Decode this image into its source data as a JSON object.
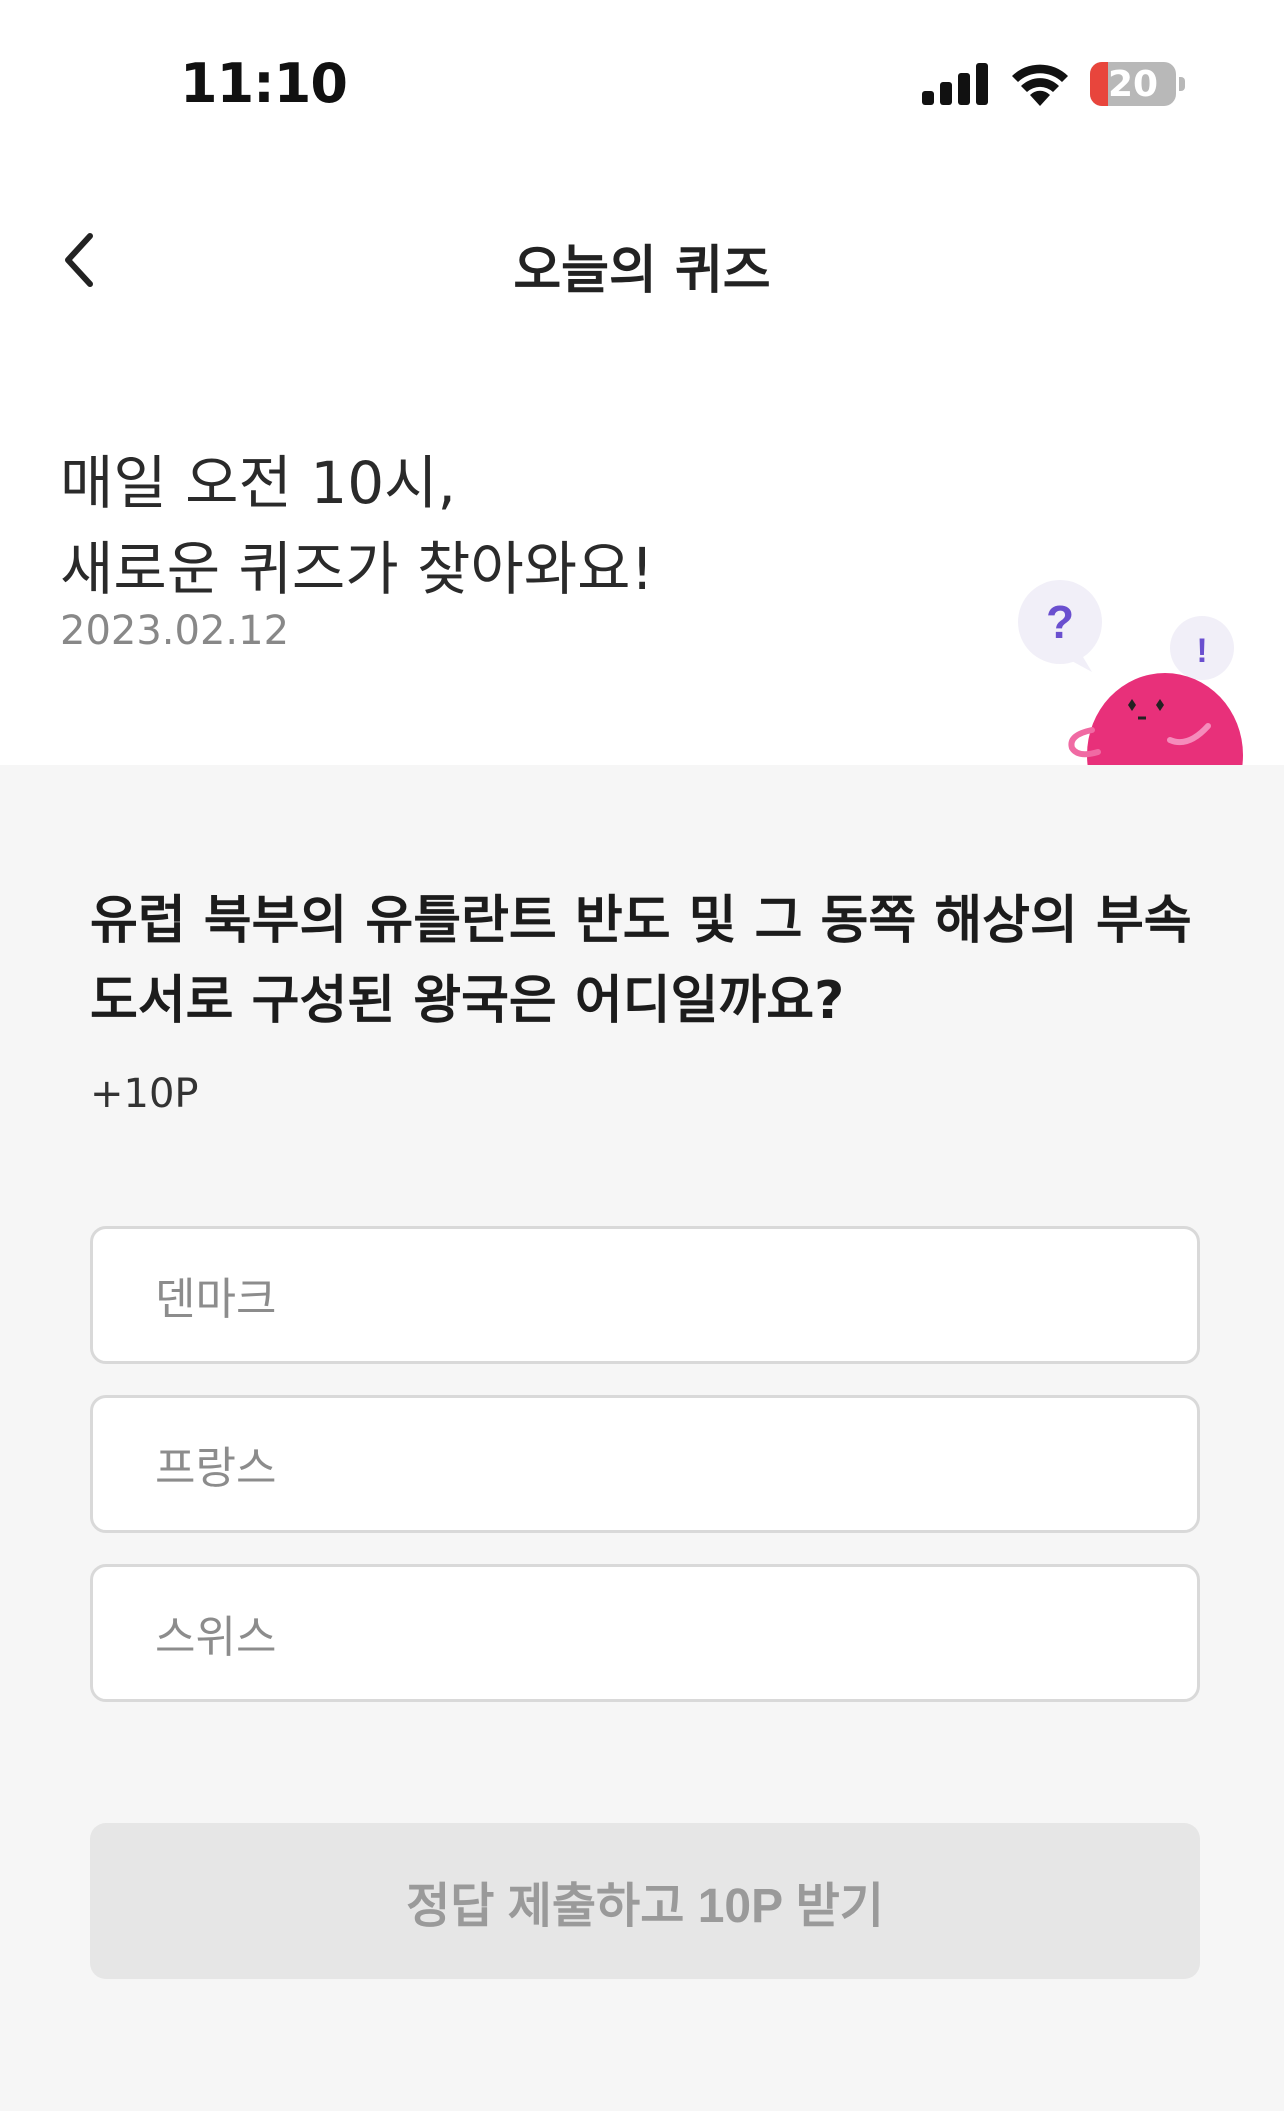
{
  "status_bar": {
    "time": "11:10",
    "battery_level": "20",
    "battery_color": "#e8453c"
  },
  "nav": {
    "title": "오늘의 퀴즈",
    "back_icon": "chevron-left-icon"
  },
  "hero": {
    "headline_line1": "매일 오전 10시,",
    "headline_line2": "새로운 퀴즈가 찾아와요!",
    "date": "2023.02.12",
    "mascot_bubble_question": "?",
    "mascot_bubble_exclaim": "!"
  },
  "quiz": {
    "question": "유럽 북부의 유틀란트 반도 및 그 동쪽 해상의 부속 도서로 구성된 왕국은 어디일까요?",
    "points": "+10P",
    "options": [
      {
        "label": "덴마크"
      },
      {
        "label": "프랑스"
      },
      {
        "label": "스위스"
      }
    ],
    "submit_label": "정답 제출하고 10P 받기"
  },
  "colors": {
    "mascot_pink": "#e8307a",
    "bubble_bg": "#f1eff8",
    "bubble_mark": "#6a4fcf"
  }
}
